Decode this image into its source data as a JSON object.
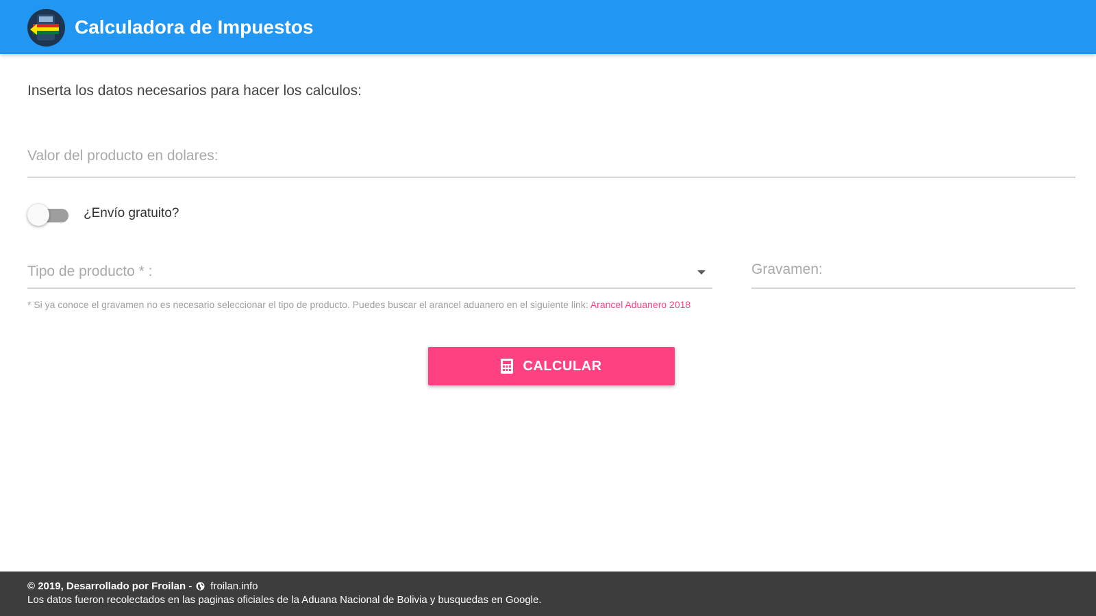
{
  "header": {
    "title": "Calculadora de Impuestos",
    "logo_icon": "bolivia-customs-logo-icon",
    "color": "#2196f3"
  },
  "main": {
    "intro_text": "Inserta los datos necesarios para hacer los calculos:",
    "value_field": {
      "value": "",
      "placeholder": "Valor del producto en dolares:"
    },
    "free_shipping": {
      "label": "¿Envío gratuito?",
      "checked": false
    },
    "product_type": {
      "placeholder": "Tipo de producto * :",
      "selected": ""
    },
    "tax_field": {
      "value": "",
      "placeholder": "Gravamen:"
    },
    "hint": {
      "text": "* Si ya conoce el gravamen no es necesario seleccionar el tipo de producto. Puedes buscar el arancel aduanero en el siguiente link: ",
      "link_text": "Arancel Aduanero 2018"
    },
    "calculate_button": {
      "label": "CALCULAR",
      "icon": "calculator-icon",
      "color": "#ff4081"
    }
  },
  "footer": {
    "copyright": "© 2019, Desarrollado por Froilan -",
    "site_icon": "globe-icon",
    "site_link": "froilan.info",
    "disclaimer": "Los datos fueron recolectados en las paginas oficiales de la Aduana Nacional de Bolivia y busquedas en Google.",
    "color": "#3d3d3d"
  }
}
